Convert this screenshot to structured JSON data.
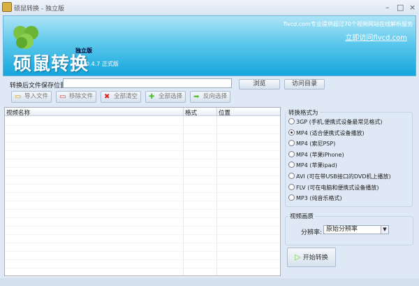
{
  "window": {
    "title": "硕鼠转换 - 独立版",
    "minimize": "–",
    "maximize": "□",
    "close": "×"
  },
  "banner": {
    "brand": "硕鼠转换",
    "edition": "独立版",
    "version": "0.4.7 正式版",
    "promo": "flvcd.com专业提供超过70个视频网站在线解析服务",
    "promo_link": "立即访问flvcd.com"
  },
  "save": {
    "label": "转换后文件保存位置:",
    "value": "",
    "browse": "浏览",
    "visit_dir": "访问目录"
  },
  "toolbar": [
    {
      "label": "导入文件",
      "icon": "folder-add-icon"
    },
    {
      "label": "移除文件",
      "icon": "folder-remove-icon"
    },
    {
      "label": "全部清空",
      "icon": "clear-x-icon"
    },
    {
      "label": "全部选择",
      "icon": "plus-icon"
    },
    {
      "label": "反向选择",
      "icon": "arrow-right-icon"
    }
  ],
  "table": {
    "columns": [
      "视频名称",
      "格式",
      "位置"
    ],
    "rows": []
  },
  "formats": {
    "title": "转换格式为",
    "selected": 1,
    "options": [
      "3GP (手机,便携式设备最常见格式)",
      "MP4 (适合便携式设备播放)",
      "MP4 (索尼PSP)",
      "MP4 (苹果iPhone)",
      "MP4 (苹果ipad)",
      "AVI (可在带USB接口的DVD机上播放)",
      "FLV (可在电脑和便携式设备播放)",
      "MP3 (纯音乐格式)"
    ]
  },
  "quality": {
    "title": "视频画质",
    "resolution_label": "分辨率:",
    "resolution_value": "原始分辨率"
  },
  "start": {
    "label": "开始转换"
  }
}
